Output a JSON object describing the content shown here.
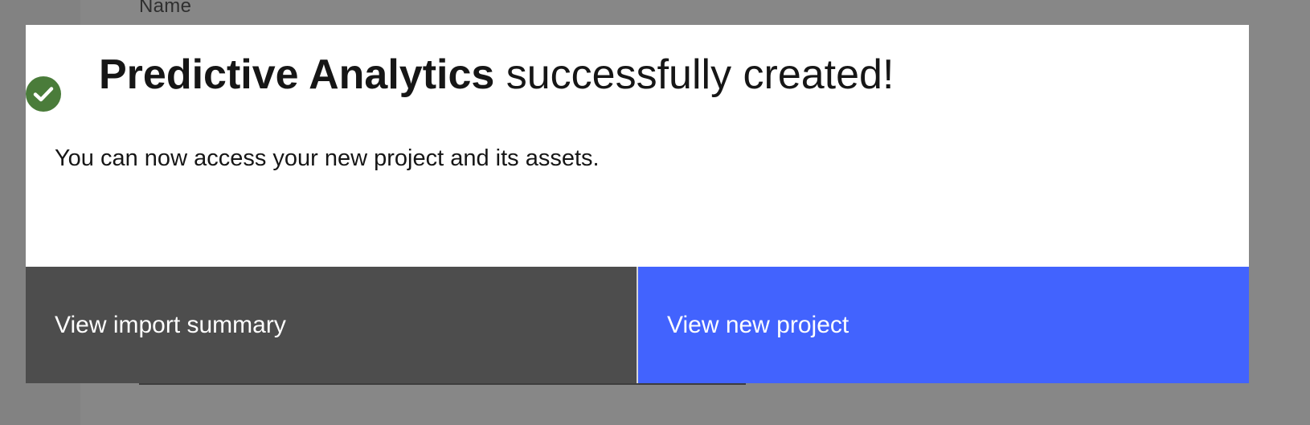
{
  "background": {
    "field_label": "Name"
  },
  "modal": {
    "title": {
      "project_name": "Predictive Analytics",
      "suffix": " successfully created!"
    },
    "status_icon": "checkmark-circle-icon",
    "body_text": "You can now access your new project and its assets.",
    "buttons": {
      "secondary_label": "View import summary",
      "primary_label": "View new project"
    }
  },
  "colors": {
    "success": "#4a7c3a",
    "primary_button": "#4263fe",
    "secondary_button": "#4d4d4d",
    "overlay": "#878787"
  }
}
